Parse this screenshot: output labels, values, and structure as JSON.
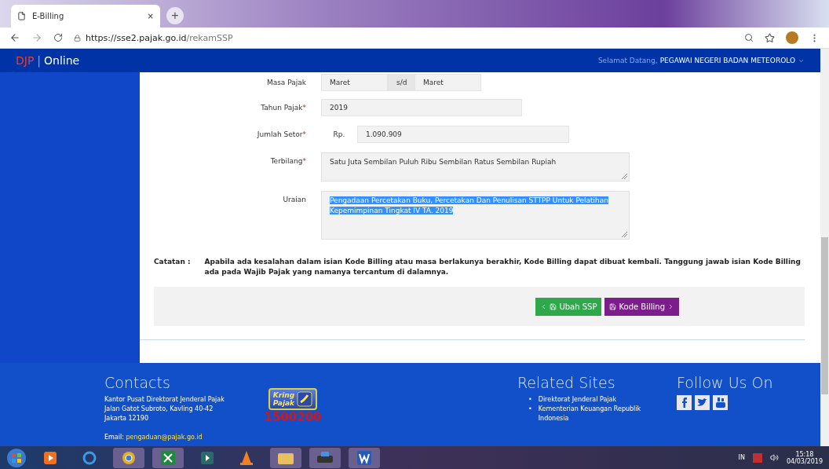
{
  "browser": {
    "tab_title": "E-Billing",
    "tab_close": "×",
    "new_tab": "+",
    "url_host": "https://sse2.pajak.go.id",
    "url_path": "/rekamSSP"
  },
  "header": {
    "logo_djp": "DJP",
    "logo_sep": "|",
    "logo_online": "Online",
    "greeting": "Selamat Datang,",
    "user": "PEGAWAI NEGERI BADAN METEOROLO"
  },
  "form": {
    "masa_pajak": {
      "label": "Masa Pajak",
      "from": "Maret",
      "sep": "s/d",
      "to": "Maret"
    },
    "fields": [
      {
        "kind": "input",
        "label": "Tahun Pajak",
        "mark": "*",
        "value": "2019"
      },
      {
        "kind": "money",
        "label": "Jumlah Setor",
        "mark": "*",
        "prefix": "Rp.",
        "value": "1.090.909"
      },
      {
        "kind": "textarea",
        "label": "Terbilang",
        "mark": "*",
        "value": "Satu Juta Sembilan Puluh  Ribu Sembilan Ratus Sembilan Rupiah",
        "selected": false
      },
      {
        "kind": "textarea",
        "label": "Uraian",
        "value": "Pengadaan Percetakan Buku, Percetakan Dan Penulisan STTPP Untuk Pelatihan Kepemimpinan Tingkat IV TA. 2019",
        "selected": true
      }
    ],
    "note_label": "Catatan :",
    "note": "Apabila ada kesalahan dalam isian Kode Billing atau masa berlakunya berakhir, Kode Billing dapat dibuat kembali. Tanggung jawab isian Kode Billing ada pada Wajib Pajak yang namanya tercantum di dalamnya.",
    "buttons": [
      {
        "kind": "back",
        "label": "Ubah SSP",
        "color": "#2ea84a"
      },
      {
        "kind": "next",
        "label": "Kode Billing",
        "color": "#7b1d8a"
      }
    ]
  },
  "footer": {
    "contacts_title": "Contacts",
    "address": [
      "Kantor Pusat Direktorat Jenderal Pajak",
      "Jalan Gatot Subroto, Kavling 40-42",
      "Jakarta 12190"
    ],
    "email_label": "Email:",
    "email": "pengaduan@pajak.go.id",
    "kring_top": "Kring",
    "kring_bottom": "Pajak",
    "phone": "1500200",
    "related_title": "Related Sites",
    "bullet": "•",
    "related": [
      "Direktorat Jenderal Pajak",
      "Kementerian Keuangan Republik Indonesia"
    ],
    "follow_title": "Follow Us On"
  },
  "taskbar": {
    "lang": "IN",
    "time": "15:18",
    "date": "04/03/2019"
  }
}
